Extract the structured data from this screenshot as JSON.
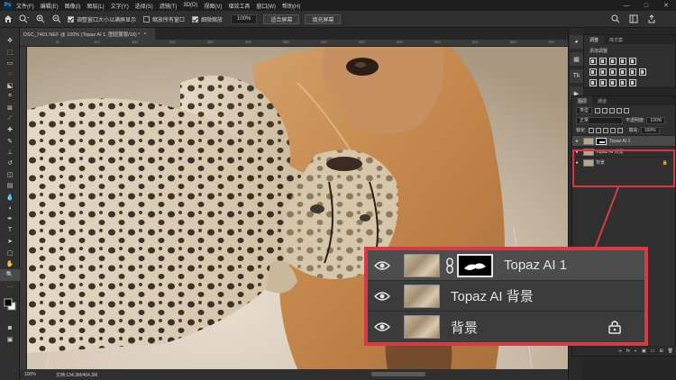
{
  "menubar": {
    "logo": "Ps",
    "items": [
      "文件(F)",
      "编辑(E)",
      "图像(I)",
      "图层(L)",
      "文字(Y)",
      "选择(S)",
      "滤镜(T)",
      "3D(D)",
      "视图(V)",
      "增效工具",
      "窗口(W)",
      "帮助(H)"
    ],
    "window_controls": [
      "—",
      "□",
      "✕"
    ]
  },
  "optionsbar": {
    "resize_windows_label": "调整窗口大小以满屏显示",
    "zoom_all_windows_label": "缩放所有窗口",
    "scrubby_zoom_label": "细微缩放",
    "zoom_value": "100%",
    "fit_screen_label": "适合屏幕",
    "fill_screen_label": "填充屏幕"
  },
  "document": {
    "tab_title": "DSC_7401.NEF @ 100% (Topaz AI 1, 图层蒙版/16) *",
    "tab_close": "×"
  },
  "ruler": {
    "marks": [
      "50",
      "100",
      "150",
      "200",
      "250",
      "300",
      "350",
      "400",
      "450",
      "500",
      "550",
      "600",
      "650",
      "700"
    ]
  },
  "statusbar": {
    "zoom": "100%",
    "doc_size": "文档:134.3M/464.3M"
  },
  "panels": {
    "adjustments": {
      "tabs": [
        "调整",
        "库方案"
      ],
      "hint": "添加调整"
    },
    "layers": {
      "tabs": [
        "图层",
        "通道"
      ],
      "filter_kind": "类型",
      "blend_mode": "正常",
      "opacity_label": "不透明度:",
      "opacity_value": "100%",
      "lock_label": "锁定:",
      "fill_label": "填充:",
      "fill_value": "100%",
      "items": [
        {
          "name": "Topaz AI 1",
          "selected": true,
          "has_mask": true,
          "locked": false
        },
        {
          "name": "Topaz AI 背景",
          "selected": false,
          "has_mask": false,
          "locked": false
        },
        {
          "name": "背景",
          "selected": false,
          "has_mask": false,
          "locked": true
        }
      ],
      "bottom_icons": [
        "fx",
        "◐",
        "▣",
        "▭",
        "⊞",
        "🗑"
      ]
    }
  },
  "colors": {
    "highlight": "#d83a45",
    "panel_bg": "#2f2f2f",
    "selected_row": "#4d4d4d"
  }
}
